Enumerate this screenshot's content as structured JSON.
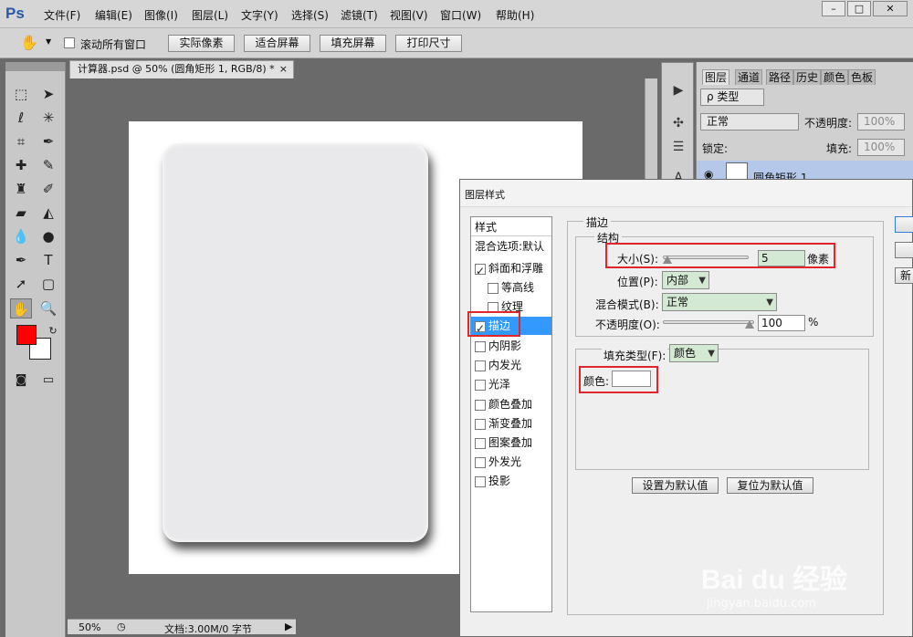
{
  "app": {
    "logo": "Ps"
  },
  "menu": [
    "文件(F)",
    "编辑(E)",
    "图像(I)",
    "图层(L)",
    "文字(Y)",
    "选择(S)",
    "滤镜(T)",
    "视图(V)",
    "窗口(W)",
    "帮助(H)"
  ],
  "window_controls": {
    "minimize": "–",
    "maximize": "□",
    "close": "✕"
  },
  "options": {
    "scroll_all_label": "滚动所有窗口",
    "actual_pixels": "实际像素",
    "fit_screen": "适合屏幕",
    "fill_screen": "填充屏幕",
    "print_size": "打印尺寸"
  },
  "document": {
    "tab_title": "计算器.psd @ 50% (圆角矩形 1, RGB/8) *",
    "tab_close": "×",
    "zoom": "50%",
    "doc_info": "文档:3.00M/0 字节",
    "fg_color": "#ff0000",
    "bg_color": "#ffffff"
  },
  "layers_panel": {
    "tabs": [
      "图层",
      "通道",
      "路径",
      "历史",
      "颜色",
      "色板"
    ],
    "filter_type": "ρ 类型",
    "blend_mode": "正常",
    "opacity_label": "不透明度:",
    "opacity_value": "100%",
    "lock_label": "锁定:",
    "fill_label": "填充:",
    "fill_value": "100%",
    "layer_name": "圆角矩形 1"
  },
  "dialog": {
    "title": "图层样式",
    "style_header": "样式",
    "blend_options": "混合选项:默认",
    "items": [
      {
        "label": "斜面和浮雕",
        "checked": true
      },
      {
        "label": "等高线",
        "checked": false
      },
      {
        "label": "纹理",
        "checked": false
      },
      {
        "label": "描边",
        "checked": true
      },
      {
        "label": "内阴影",
        "checked": false
      },
      {
        "label": "内发光",
        "checked": false
      },
      {
        "label": "光泽",
        "checked": false
      },
      {
        "label": "颜色叠加",
        "checked": false
      },
      {
        "label": "渐变叠加",
        "checked": false
      },
      {
        "label": "图案叠加",
        "checked": false
      },
      {
        "label": "外发光",
        "checked": false
      },
      {
        "label": "投影",
        "checked": false
      }
    ],
    "stroke_group": "描边",
    "structure_group": "结构",
    "size_label": "大小(S):",
    "size_value": "5",
    "size_unit": "像素",
    "position_label": "位置(P):",
    "position_value": "内部",
    "blend_label": "混合模式(B):",
    "blend_value": "正常",
    "opacity_label": "不透明度(O):",
    "opacity_value": "100",
    "opacity_unit": "%",
    "fill_type_label": "填充类型(F):",
    "fill_type_value": "颜色",
    "color_label": "颜色:",
    "stroke_color": "#ffffff",
    "set_default": "设置为默认值",
    "reset_default": "复位为默认值",
    "right_button_text": "新"
  },
  "watermark": {
    "brand": "Bai du 经验",
    "url": "jingyan.baidu.com"
  }
}
